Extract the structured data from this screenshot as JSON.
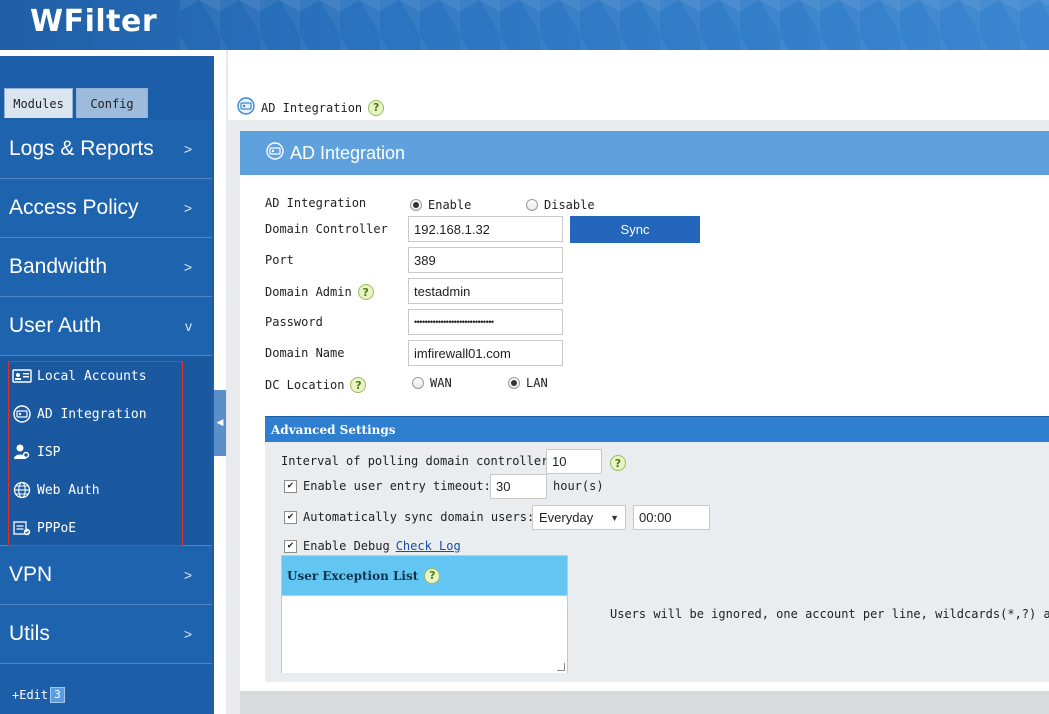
{
  "app": {
    "brand": "WFilter"
  },
  "sidebar": {
    "tabs": [
      {
        "label": "Modules"
      },
      {
        "label": "Config"
      }
    ],
    "menu": [
      {
        "label": "Logs & Reports",
        "chevron": ">"
      },
      {
        "label": "Access Policy",
        "chevron": ">"
      },
      {
        "label": "Bandwidth",
        "chevron": ">"
      },
      {
        "label": "User Auth",
        "chevron": "v"
      },
      {
        "label": "VPN",
        "chevron": ">"
      },
      {
        "label": "Utils",
        "chevron": ">"
      }
    ],
    "submenu": [
      {
        "label": "Local Accounts",
        "icon": "id-card-icon"
      },
      {
        "label": "AD Integration",
        "icon": "ad-integration-icon"
      },
      {
        "label": "ISP",
        "icon": "user-key-icon"
      },
      {
        "label": "Web Auth",
        "icon": "globe-icon"
      },
      {
        "label": "PPPoE",
        "icon": "pppoe-icon"
      }
    ],
    "edit": {
      "label": "+Edit",
      "badge": "3"
    }
  },
  "breadcrumb": {
    "label": "AD Integration",
    "help": "?"
  },
  "panel": {
    "title": "AD Integration",
    "fields": {
      "ad_integration": {
        "label": "AD Integration",
        "enable": "Enable",
        "disable": "Disable",
        "selected": "Enable"
      },
      "domain_controller": {
        "label": "Domain Controller",
        "value": "192.168.1.32"
      },
      "sync_button": "Sync",
      "port": {
        "label": "Port",
        "value": "389"
      },
      "domain_admin": {
        "label": "Domain Admin",
        "value": "testadmin",
        "help": "?"
      },
      "password": {
        "label": "Password",
        "value": "••••••••••••••••••••••••••••••"
      },
      "domain_name": {
        "label": "Domain Name",
        "value": "imfirewall01.com"
      },
      "dc_location": {
        "label": "DC Location",
        "wan": "WAN",
        "lan": "LAN",
        "selected": "LAN",
        "help": "?"
      }
    },
    "advanced": {
      "title": "Advanced Settings",
      "polling": {
        "label": "Interval of polling domain controller:",
        "value": "10",
        "help": "?"
      },
      "entry_timeout": {
        "label": "Enable user entry timeout:",
        "value": "30",
        "unit": "hour(s)",
        "checked": true
      },
      "auto_sync": {
        "label": "Automatically sync domain users:",
        "frequency": "Everyday",
        "time": "00:00",
        "checked": true
      },
      "debug": {
        "label": "Enable Debug",
        "link": "Check Log",
        "checked": true
      },
      "exception": {
        "title": "User Exception List",
        "help": "?"
      },
      "note": "Users will be ignored, one account per line, wildcards(*,?) are s"
    }
  },
  "colors": {
    "header": "#2a73c0",
    "sidebar": "#1d5ea8",
    "panel_header": "#5ea1dc",
    "sync_button": "#2366bb",
    "exception_header": "#63c6f2",
    "frame": "#e03030"
  }
}
